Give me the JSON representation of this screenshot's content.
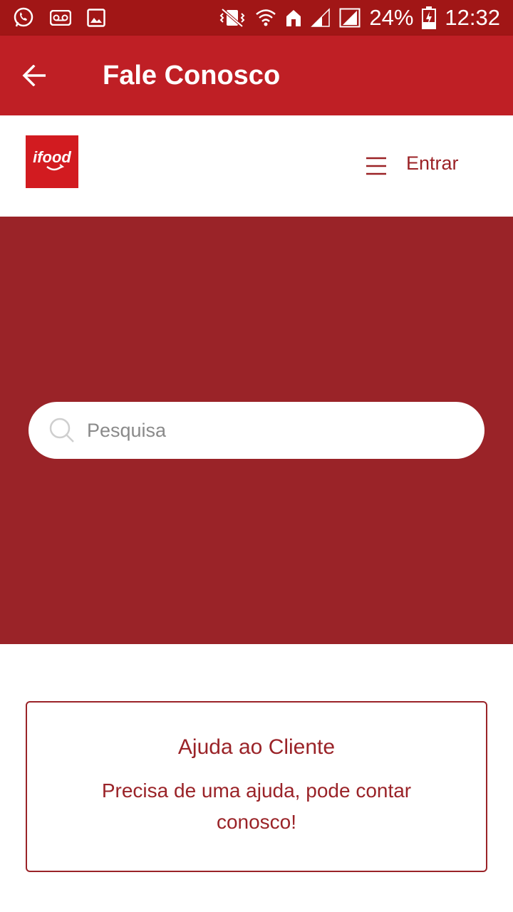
{
  "status_bar": {
    "battery": "24%",
    "time": "12:32",
    "icons": [
      "whatsapp-icon",
      "voicemail-icon",
      "image-icon",
      "vibrate-mute-icon",
      "wifi-icon",
      "home-icon",
      "signal-icon",
      "signal-full-icon",
      "battery-charging-icon"
    ]
  },
  "app_bar": {
    "title": "Fale Conosco",
    "back_icon": "arrow-left-icon"
  },
  "header": {
    "logo_text": "ifood",
    "login_label": "Entrar",
    "menu_icon": "hamburger-menu-icon"
  },
  "search": {
    "placeholder": "Pesquisa",
    "value": ""
  },
  "help_card": {
    "title": "Ajuda ao Cliente",
    "description": "Precisa de uma ajuda, pode contar conosco!"
  },
  "colors": {
    "status_bar": "#a11616",
    "app_bar": "#bf1f25",
    "hero": "#9a2328",
    "accent": "#9a2328",
    "logo": "#d21b20"
  }
}
